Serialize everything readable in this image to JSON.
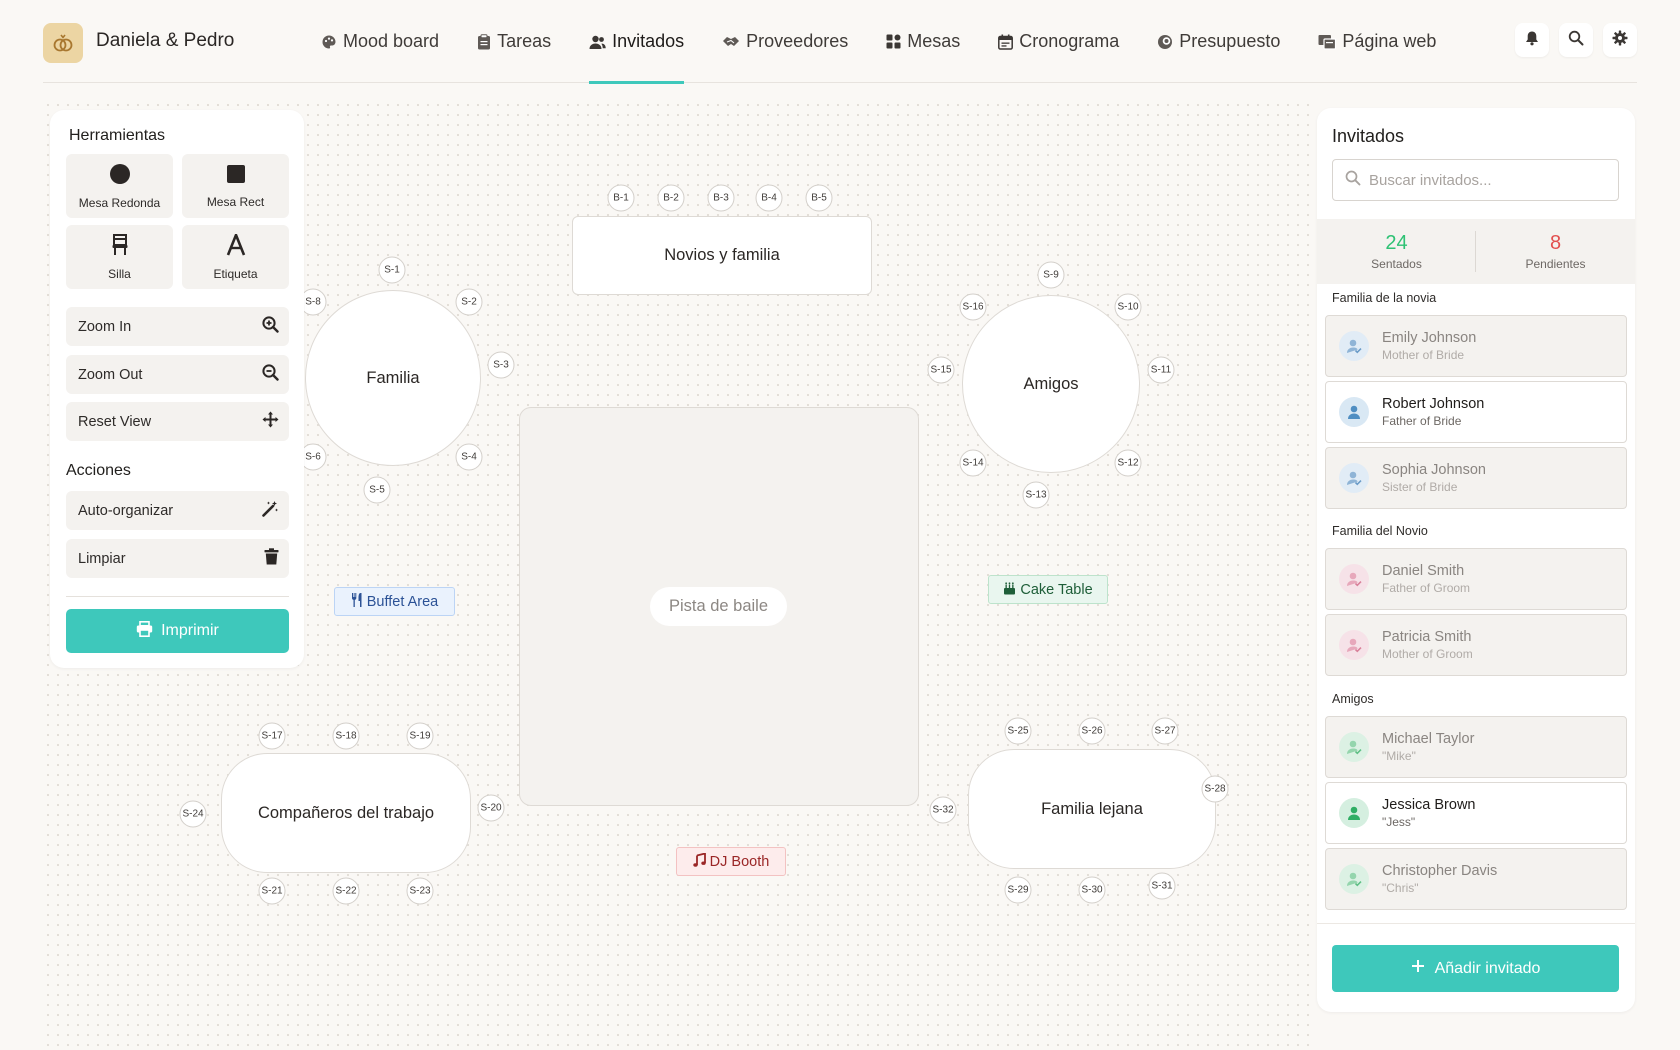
{
  "app": {
    "couple_name": "Daniela & Pedro",
    "nav": [
      {
        "label": "Mood board",
        "icon": "palette-icon"
      },
      {
        "label": "Tareas",
        "icon": "clipboard-icon"
      },
      {
        "label": "Invitados",
        "icon": "users-icon",
        "active": true
      },
      {
        "label": "Proveedores",
        "icon": "handshake-icon"
      },
      {
        "label": "Mesas",
        "icon": "grid-icon"
      },
      {
        "label": "Cronograma",
        "icon": "calendar-icon"
      },
      {
        "label": "Presupuesto",
        "icon": "coins-icon"
      },
      {
        "label": "Página web",
        "icon": "web-icon"
      }
    ],
    "accent_color": "#3ec8bb"
  },
  "tools": {
    "title": "Herramientas",
    "tiles": [
      "Mesa Redonda",
      "Mesa Rect",
      "Silla",
      "Etiqueta"
    ],
    "zoom_in": "Zoom In",
    "zoom_out": "Zoom Out",
    "reset_view": "Reset View",
    "actions_title": "Acciones",
    "auto_organize": "Auto-organizar",
    "clear": "Limpiar",
    "print": "Imprimir"
  },
  "floor": {
    "tables": {
      "familia": "Familia",
      "novios": "Novios y familia",
      "amigos": "Amigos",
      "trabajo": "Compañeros del trabajo",
      "lejana": "Familia lejana"
    },
    "dance_floor": "Pista de baile",
    "markers": {
      "buffet": "Buffet Area",
      "cake": "Cake Table",
      "dj": "DJ Booth"
    },
    "seats": {
      "b1": "B-1",
      "b2": "B-2",
      "b3": "B-3",
      "b4": "B-4",
      "b5": "B-5",
      "s1": "S-1",
      "s2": "S-2",
      "s3": "S-3",
      "s4": "S-4",
      "s5": "S-5",
      "s6": "S-6",
      "s8": "S-8",
      "s9": "S-9",
      "s10": "S-10",
      "s11": "S-11",
      "s12": "S-12",
      "s13": "S-13",
      "s14": "S-14",
      "s15": "S-15",
      "s16": "S-16",
      "s17": "S-17",
      "s18": "S-18",
      "s19": "S-19",
      "s20": "S-20",
      "s21": "S-21",
      "s22": "S-22",
      "s23": "S-23",
      "s24": "S-24",
      "s25": "S-25",
      "s26": "S-26",
      "s27": "S-27",
      "s28": "S-28",
      "s29": "S-29",
      "s30": "S-30",
      "s31": "S-31",
      "s32": "S-32"
    }
  },
  "guests": {
    "title": "Invitados",
    "search_placeholder": "Buscar invitados...",
    "seated_count": "24",
    "seated_label": "Sentados",
    "pending_count": "8",
    "pending_label": "Pendientes",
    "groups": [
      {
        "title": "Familia de la novia",
        "members": [
          {
            "name": "Emily Johnson",
            "sub": "Mother of Bride",
            "seated": true
          },
          {
            "name": "Robert Johnson",
            "sub": "Father of Bride",
            "seated": false
          },
          {
            "name": "Sophia Johnson",
            "sub": "Sister of Bride",
            "seated": true
          }
        ]
      },
      {
        "title": "Familia del Novio",
        "members": [
          {
            "name": "Daniel Smith",
            "sub": "Father of Groom",
            "seated": true
          },
          {
            "name": "Patricia Smith",
            "sub": "Mother of Groom",
            "seated": true
          }
        ]
      },
      {
        "title": "Amigos",
        "members": [
          {
            "name": "Michael Taylor",
            "sub": "\"Mike\"",
            "seated": true
          },
          {
            "name": "Jessica Brown",
            "sub": "\"Jess\"",
            "seated": false
          },
          {
            "name": "Christopher Davis",
            "sub": "\"Chris\"",
            "seated": true
          }
        ]
      }
    ],
    "add_button": "Añadir invitado"
  }
}
